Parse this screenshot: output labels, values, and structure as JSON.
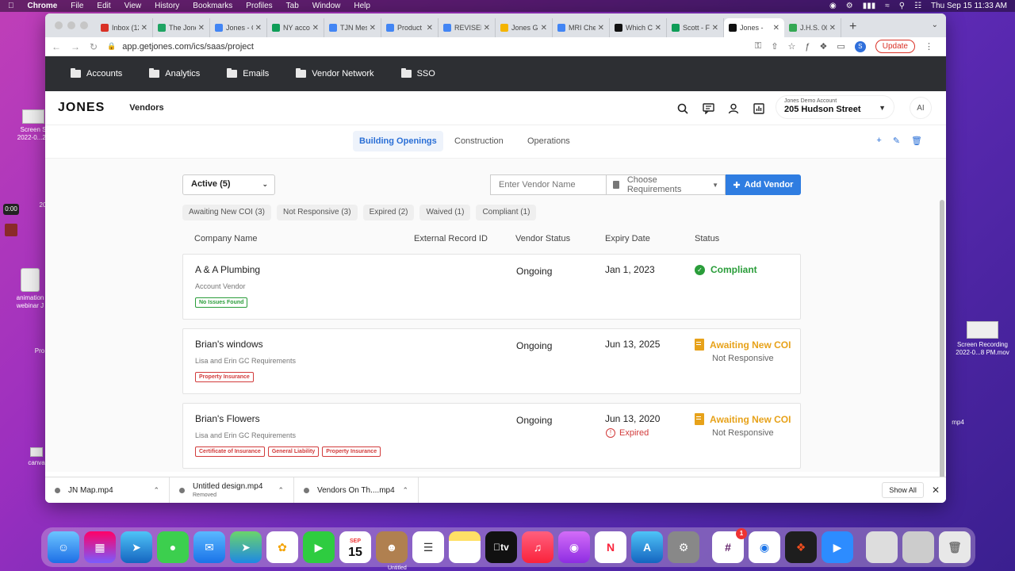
{
  "menubar": {
    "items": [
      "Chrome",
      "File",
      "Edit",
      "View",
      "History",
      "Bookmarks",
      "Profiles",
      "Tab",
      "Window",
      "Help"
    ],
    "datetime": "Thu Sep 15  11:33 AM"
  },
  "desktop": {
    "screen1": "Screen S\n2022-0...22",
    "anim": "animation\nwebinar J",
    "pro": "Pro",
    "canva": "canva",
    "recording": "Screen Recording\n2022-0...8 PM.mov",
    "mp4": "mp4",
    "timer": "0:00",
    "twenty": "20"
  },
  "browser": {
    "tabs": [
      {
        "title": "Inbox (12",
        "color": "#d93025"
      },
      {
        "title": "The Jone",
        "color": "#1fa463"
      },
      {
        "title": "Jones - C",
        "color": "#4285f4"
      },
      {
        "title": "NY accou",
        "color": "#0f9d58"
      },
      {
        "title": "TJN Mes",
        "color": "#4285f4"
      },
      {
        "title": "Product",
        "color": "#4285f4"
      },
      {
        "title": "REVISED",
        "color": "#4285f4"
      },
      {
        "title": "Jones Gi",
        "color": "#f4b400"
      },
      {
        "title": "MRI Che",
        "color": "#4285f4"
      },
      {
        "title": "Which C",
        "color": "#111111"
      },
      {
        "title": "Scott - F",
        "color": "#0f9d58"
      },
      {
        "title": "Jones - ",
        "color": "#111111",
        "active": true
      },
      {
        "title": "J.H.S. 00",
        "color": "#34a853"
      }
    ],
    "url": "app.getjones.com/ics/saas/project",
    "profile_initial": "S",
    "update_label": "Update"
  },
  "appnav": {
    "items": [
      "Accounts",
      "Analytics",
      "Emails",
      "Vendor Network",
      "SSO"
    ]
  },
  "header": {
    "logo": "JONES",
    "section": "Vendors",
    "account_label": "Jones Demo Account",
    "account_name": "205 Hudson Street",
    "user_initials": "AI"
  },
  "subtabs": [
    "Building Openings",
    "Construction",
    "Operations"
  ],
  "filters": {
    "active_select": "Active (5)",
    "vendor_placeholder": "Enter Vendor Name",
    "requirements": "Choose Requirements",
    "add_vendor": "Add Vendor",
    "chips": [
      "Awaiting New COI (3)",
      "Not Responsive (3)",
      "Expired (2)",
      "Waived (1)",
      "Compliant (1)"
    ]
  },
  "table": {
    "columns": [
      "Company Name",
      "External Record ID",
      "Vendor Status",
      "Expiry Date",
      "Status"
    ],
    "rows": [
      {
        "name": "A & A Plumbing",
        "type": "Account Vendor",
        "tags": [
          "No Issues Found"
        ],
        "vendor_status": "Ongoing",
        "expiry": "Jan 1, 2023",
        "expired_label": "",
        "status": "Compliant",
        "sub_status": ""
      },
      {
        "name": "Brian's windows",
        "type": "Lisa and Erin GC Requirements",
        "tags": [
          "Property Insurance"
        ],
        "vendor_status": "Ongoing",
        "expiry": "Jun 13, 2025",
        "expired_label": "",
        "status": "Awaiting New COI",
        "sub_status": "Not Responsive"
      },
      {
        "name": "Brian's Flowers",
        "type": "Lisa and Erin GC Requirements",
        "tags": [
          "Certificate of Insurance",
          "General Liability",
          "Property Insurance"
        ],
        "vendor_status": "Ongoing",
        "expiry": "Jun 13, 2020",
        "expired_label": "Expired",
        "status": "Awaiting New COI",
        "sub_status": "Not Responsive"
      }
    ]
  },
  "downloads": [
    {
      "name": "JN Map.mp4",
      "note": ""
    },
    {
      "name": "Untitled design.mp4",
      "note": "Removed"
    },
    {
      "name": "Vendors On Th....mp4",
      "note": ""
    }
  ],
  "downloads_show_all": "Show All",
  "dock": {
    "calendar_month": "SEP",
    "calendar_day": "15",
    "slack_badge": "1",
    "tv_label": "tv",
    "untitled": "Untitled"
  }
}
